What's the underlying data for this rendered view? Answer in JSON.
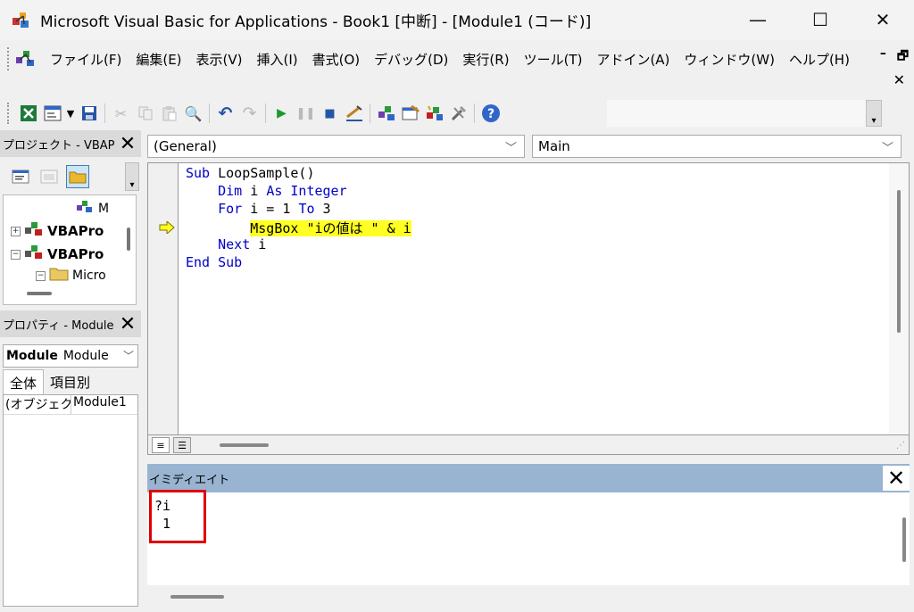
{
  "window": {
    "title": "Microsoft Visual Basic for Applications - Book1 [中断] - [Module1 (コード)]",
    "minimize": "—",
    "maximize": "☐",
    "close": "✕"
  },
  "menu": {
    "items": [
      {
        "label": "ファイル(F)"
      },
      {
        "label": "編集(E)"
      },
      {
        "label": "表示(V)"
      },
      {
        "label": "挿入(I)"
      },
      {
        "label": "書式(O)"
      },
      {
        "label": "デバッグ(D)"
      },
      {
        "label": "実行(R)"
      },
      {
        "label": "ツール(T)"
      },
      {
        "label": "アドイン(A)"
      },
      {
        "label": "ウィンドウ(W)"
      },
      {
        "label": "ヘルプ(H)"
      }
    ],
    "mdi_minimize": "–",
    "mdi_restore": "🗗",
    "mdi_close": "✕"
  },
  "project_pane": {
    "title": "プロジェクト - VBAP",
    "close": "✕",
    "tree": [
      {
        "label": "M"
      },
      {
        "label": "VBAPro"
      },
      {
        "label": "VBAPro"
      },
      {
        "label": "Micro"
      }
    ]
  },
  "properties_pane": {
    "title": "プロパティ - Module",
    "close": "✕",
    "combo_bold": "Module",
    "combo_rest": "Module",
    "tabs": [
      "全体",
      "項目別"
    ],
    "rows": [
      {
        "key": "(オブジェク",
        "value": "Module1"
      }
    ]
  },
  "code_window": {
    "object_combo": "(General)",
    "procedure_combo": "Main",
    "lines": [
      "Sub LoopSample()",
      "    Dim i As Integer",
      "    For i = 1 To 3",
      "        MsgBox \"iの値は \" & i",
      "    Next i",
      "End Sub"
    ]
  },
  "immediate": {
    "title": "イミディエイト",
    "close": "✕",
    "lines": [
      "?i",
      " 1"
    ]
  },
  "colors": {
    "keyword": "#0000c8",
    "highlight": "#ffff22",
    "immediate_title_bg": "#99b4d1",
    "annotation_box": "#e00000"
  }
}
